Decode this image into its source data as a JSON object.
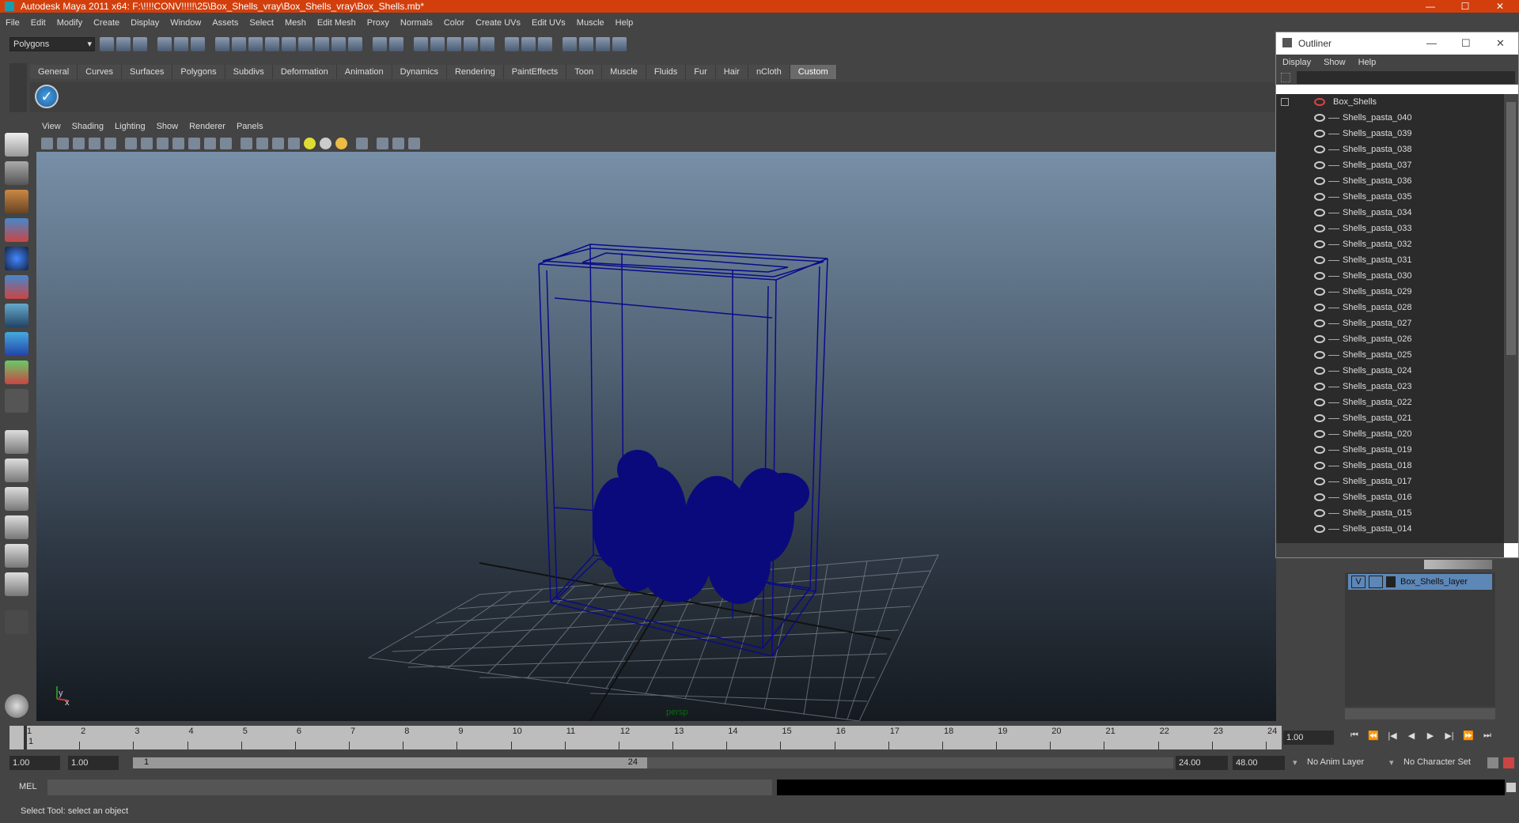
{
  "window": {
    "title": "Autodesk Maya 2011 x64: F:\\!!!!CONV!!!!!\\25\\Box_Shells_vray\\Box_Shells_vray\\Box_Shells.mb*",
    "controls": [
      "—",
      "☐",
      "✕"
    ]
  },
  "menubar": [
    "File",
    "Edit",
    "Modify",
    "Create",
    "Display",
    "Window",
    "Assets",
    "Select",
    "Mesh",
    "Edit Mesh",
    "Proxy",
    "Normals",
    "Color",
    "Create UVs",
    "Edit UVs",
    "Muscle",
    "Help"
  ],
  "mode_selector": "Polygons",
  "shelf_tabs": [
    {
      "label": "General",
      "active": false
    },
    {
      "label": "Curves",
      "active": false
    },
    {
      "label": "Surfaces",
      "active": false
    },
    {
      "label": "Polygons",
      "active": false
    },
    {
      "label": "Subdivs",
      "active": false
    },
    {
      "label": "Deformation",
      "active": false
    },
    {
      "label": "Animation",
      "active": false
    },
    {
      "label": "Dynamics",
      "active": false
    },
    {
      "label": "Rendering",
      "active": false
    },
    {
      "label": "PaintEffects",
      "active": false
    },
    {
      "label": "Toon",
      "active": false
    },
    {
      "label": "Muscle",
      "active": false
    },
    {
      "label": "Fluids",
      "active": false
    },
    {
      "label": "Fur",
      "active": false
    },
    {
      "label": "Hair",
      "active": false
    },
    {
      "label": "nCloth",
      "active": false
    },
    {
      "label": "Custom",
      "active": true
    }
  ],
  "panel_menu": [
    "View",
    "Shading",
    "Lighting",
    "Show",
    "Renderer",
    "Panels"
  ],
  "viewport": {
    "label": "persp",
    "wire_color": "#0a0a8a"
  },
  "outliner": {
    "title": "Outliner",
    "menu": [
      "Display",
      "Show",
      "Help"
    ],
    "root": "Box_Shells",
    "items": [
      "Shells_pasta_040",
      "Shells_pasta_039",
      "Shells_pasta_038",
      "Shells_pasta_037",
      "Shells_pasta_036",
      "Shells_pasta_035",
      "Shells_pasta_034",
      "Shells_pasta_033",
      "Shells_pasta_032",
      "Shells_pasta_031",
      "Shells_pasta_030",
      "Shells_pasta_029",
      "Shells_pasta_028",
      "Shells_pasta_027",
      "Shells_pasta_026",
      "Shells_pasta_025",
      "Shells_pasta_024",
      "Shells_pasta_023",
      "Shells_pasta_022",
      "Shells_pasta_021",
      "Shells_pasta_020",
      "Shells_pasta_019",
      "Shells_pasta_018",
      "Shells_pasta_017",
      "Shells_pasta_016",
      "Shells_pasta_015",
      "Shells_pasta_014"
    ]
  },
  "layer": {
    "visibility": "V",
    "name": "Box_Shells_layer"
  },
  "timeline": {
    "start": 1,
    "end": 24,
    "current": 1,
    "current_time_field": "1.00",
    "ticks": [
      1,
      2,
      3,
      4,
      5,
      6,
      7,
      8,
      9,
      10,
      11,
      12,
      13,
      14,
      15,
      16,
      17,
      18,
      19,
      20,
      21,
      22,
      23,
      24
    ]
  },
  "range": {
    "start_time": "1.00",
    "playback_start": "1.00",
    "slider_start": "1",
    "slider_end": "24",
    "playback_end": "24.00",
    "end_time": "48.00",
    "anim_layer": "No Anim Layer",
    "char_set": "No Character Set"
  },
  "command_line": {
    "label": "MEL"
  },
  "help_line": "Select Tool: select an object",
  "playback_buttons": [
    "⏮",
    "⏪",
    "|◀",
    "◀",
    "▶",
    "▶|",
    "⏩",
    "⏭"
  ]
}
